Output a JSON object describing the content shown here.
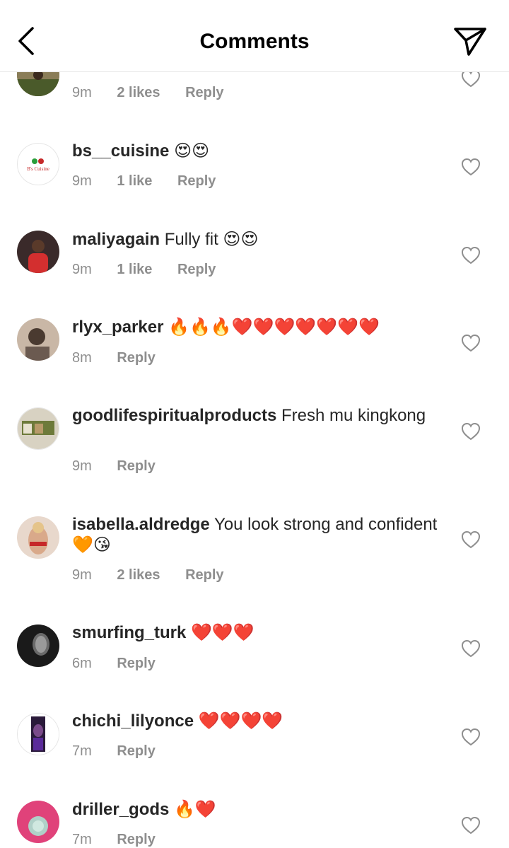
{
  "header": {
    "title": "Comments"
  },
  "comments": [
    {
      "username": "",
      "text": "",
      "emojis": "",
      "time": "9m",
      "likes": "2 likes",
      "reply": "Reply"
    },
    {
      "username": "bs__cuisine",
      "text": "",
      "emojis": "😍😍",
      "time": "9m",
      "likes": "1 like",
      "reply": "Reply"
    },
    {
      "username": "maliyagain",
      "text": "Fully fit",
      "emojis": "😍😍",
      "time": "9m",
      "likes": "1 like",
      "reply": "Reply"
    },
    {
      "username": "rlyx_parker",
      "text": "",
      "emojis": "🔥🔥🔥❤️❤️❤️❤️❤️❤️❤️",
      "time": "8m",
      "likes": "",
      "reply": "Reply"
    },
    {
      "username": "goodlifespiritualproducts",
      "text": "Fresh mu kingkong",
      "emojis": "",
      "time": "9m",
      "likes": "",
      "reply": "Reply"
    },
    {
      "username": "isabella.aldredge",
      "text": "You look strong and confident",
      "emojis": "🧡😘",
      "time": "9m",
      "likes": "2 likes",
      "reply": "Reply"
    },
    {
      "username": "smurfing_turk",
      "text": "",
      "emojis": "❤️❤️❤️",
      "time": "6m",
      "likes": "",
      "reply": "Reply"
    },
    {
      "username": "chichi_lilyonce",
      "text": "",
      "emojis": "❤️❤️❤️❤️",
      "time": "7m",
      "likes": "",
      "reply": "Reply"
    },
    {
      "username": "driller_gods",
      "text": "",
      "emojis": "🔥❤️",
      "time": "7m",
      "likes": "",
      "reply": "Reply"
    }
  ],
  "avatars": {
    "bs_logo_text": "B's Cuisine"
  },
  "icons": {
    "back": "chevron-left-icon",
    "share": "paper-plane-icon",
    "like": "heart-outline-icon"
  },
  "colors": {
    "text": "#262626",
    "meta": "#8e8e8e",
    "divider": "#e6e6e6"
  }
}
